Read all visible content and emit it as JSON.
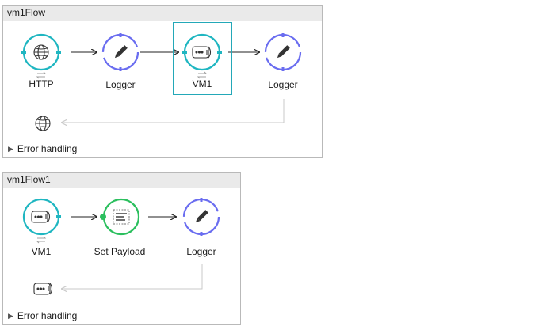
{
  "flows": [
    {
      "title": "vm1Flow",
      "source_label": "HTTP",
      "nodes": [
        {
          "label": "Logger"
        },
        {
          "label": "VM1"
        },
        {
          "label": "Logger"
        }
      ],
      "error_handling_label": "Error handling"
    },
    {
      "title": "vm1Flow1",
      "source_label": "VM1",
      "nodes": [
        {
          "label": "Set Payload"
        },
        {
          "label": "Logger"
        }
      ],
      "error_handling_label": "Error handling"
    }
  ],
  "icons": {
    "http": "globe-icon",
    "logger": "pencil-icon",
    "vm": "vm-queue-icon",
    "set_payload": "set-payload-icon",
    "exchange": "exchange-arrows-icon"
  },
  "colors": {
    "source_ring": "#1fb6c1",
    "logger_ring": "#6a6df0",
    "payload_ring": "#2bbf5e",
    "selection": "#23a8b8"
  }
}
